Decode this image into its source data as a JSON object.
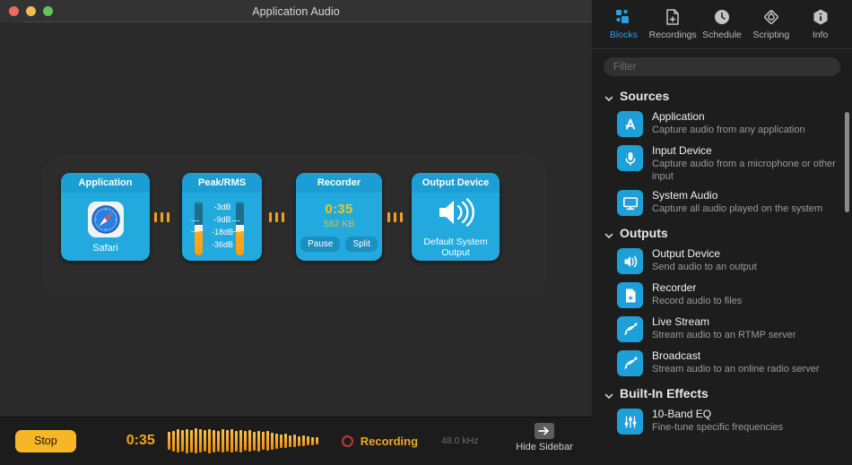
{
  "window": {
    "title": "Application Audio",
    "traffic_lights": [
      "close-red",
      "minimize-yellow",
      "zoom-green"
    ]
  },
  "canvas": {
    "blocks": [
      {
        "id": "application",
        "header": "Application",
        "icon": "safari-icon",
        "app_name": "Safari"
      },
      {
        "id": "peak-rms",
        "header": "Peak/RMS",
        "scale_labels": [
          "-3dB",
          "-9dB",
          "-18dB",
          "-36dB"
        ],
        "meters": [
          {
            "name": "peak-meter",
            "level_pct": 45
          },
          {
            "name": "rms-meter",
            "level_pct": 45
          }
        ]
      },
      {
        "id": "recorder",
        "header": "Recorder",
        "time": "0:35",
        "size": "582 KB",
        "buttons": [
          "Pause",
          "Split"
        ]
      },
      {
        "id": "output-device",
        "header": "Output Device",
        "icon": "speaker-icon",
        "device_name": "Default System\nOutput",
        "device_name_line1": "Default System",
        "device_name_line2": "Output"
      }
    ],
    "connector_dots": 3
  },
  "bottom_bar": {
    "stop_label": "Stop",
    "elapsed": "0:35",
    "recording_label": "Recording",
    "sample_rate": "48.0 kHz",
    "hide_sidebar_label": "Hide Sidebar",
    "waveform": [
      20,
      23,
      26,
      24,
      27,
      25,
      28,
      26,
      24,
      27,
      25,
      23,
      26,
      24,
      26,
      23,
      25,
      22,
      24,
      21,
      23,
      20,
      22,
      19,
      17,
      15,
      16,
      13,
      14,
      11,
      12,
      10,
      9,
      8
    ],
    "accent_orange": "#f0a81c",
    "record_red": "#c0392b"
  },
  "sidebar": {
    "toolbar": [
      {
        "label": "Blocks",
        "icon": "blocks-icon",
        "active": true
      },
      {
        "label": "Recordings",
        "icon": "recordings-icon",
        "active": false
      },
      {
        "label": "Schedule",
        "icon": "clock-icon",
        "active": false
      },
      {
        "label": "Scripting",
        "icon": "scripting-icon",
        "active": false
      },
      {
        "label": "Info",
        "icon": "info-icon",
        "active": false
      }
    ],
    "filter_placeholder": "Filter",
    "filter_value": "",
    "sections": [
      {
        "title": "Sources",
        "expanded": true,
        "items": [
          {
            "title": "Application",
            "subtitle": "Capture audio from any application",
            "icon": "appstore-icon"
          },
          {
            "title": "Input Device",
            "subtitle": "Capture audio from a microphone or other input",
            "icon": "microphone-icon"
          },
          {
            "title": "System Audio",
            "subtitle": "Capture all audio played on the system",
            "icon": "monitor-icon"
          }
        ]
      },
      {
        "title": "Outputs",
        "expanded": true,
        "items": [
          {
            "title": "Output Device",
            "subtitle": "Send audio to an output",
            "icon": "speaker-icon"
          },
          {
            "title": "Recorder",
            "subtitle": "Record audio to files",
            "icon": "document-plus-icon"
          },
          {
            "title": "Live Stream",
            "subtitle": "Stream audio to an RTMP server",
            "icon": "satellite-dish-icon"
          },
          {
            "title": "Broadcast",
            "subtitle": "Stream audio to an online radio server",
            "icon": "satellite-dish-icon"
          }
        ]
      },
      {
        "title": "Built-In Effects",
        "expanded": true,
        "items": [
          {
            "title": "10-Band EQ",
            "subtitle": "Fine-tune specific frequencies",
            "icon": "equalizer-icon"
          }
        ]
      }
    ],
    "accent_blue": "#2a9fe0",
    "tile_blue": "#1f9fd8"
  }
}
